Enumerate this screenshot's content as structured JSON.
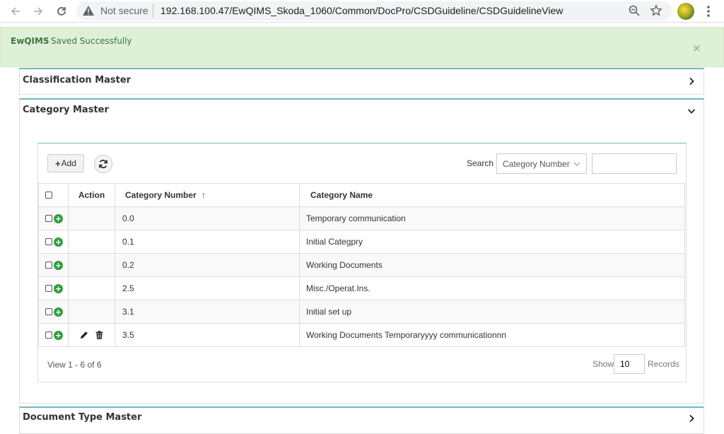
{
  "browser": {
    "security_text": "Not secure",
    "url": "192.168.100.47/EwQIMS_Skoda_1060/Common/DocPro/CSDGuideline/CSDGuidelineView"
  },
  "alert": {
    "brand": "EwQIMS",
    "message": ": Saved Successfully",
    "close": "×"
  },
  "panels": {
    "classification": "Classification Master",
    "category": "Category Master",
    "document_type": "Document Type Master"
  },
  "toolbar": {
    "add_label": "Add",
    "search_label": "Search",
    "search_field": "Category Number",
    "search_value": ""
  },
  "table": {
    "headers": {
      "action": "Action",
      "category_number": "Category Number",
      "sort_arrow": "↑",
      "category_name": "Category Name"
    },
    "rows": [
      {
        "number": "0.0",
        "name": "Temporary communication"
      },
      {
        "number": "0.1",
        "name": "Initial Categpry"
      },
      {
        "number": "0.2",
        "name": "Working Documents"
      },
      {
        "number": "2.5",
        "name": "Misc./Operat.Ins."
      },
      {
        "number": "3.1",
        "name": "Initial set up"
      },
      {
        "number": "3.5",
        "name": "Working Documents Temporaryyyy communicationnn"
      }
    ]
  },
  "footer": {
    "view_info": "View 1 - 6 of 6",
    "show_label": "Show",
    "page_size": "10",
    "records_label": "Records"
  },
  "colors": {
    "alert_bg": "#dff0d8",
    "alert_text": "#3c763d",
    "panel_accent": "#6cb8b8",
    "add_icon": "#2e9e3e"
  }
}
